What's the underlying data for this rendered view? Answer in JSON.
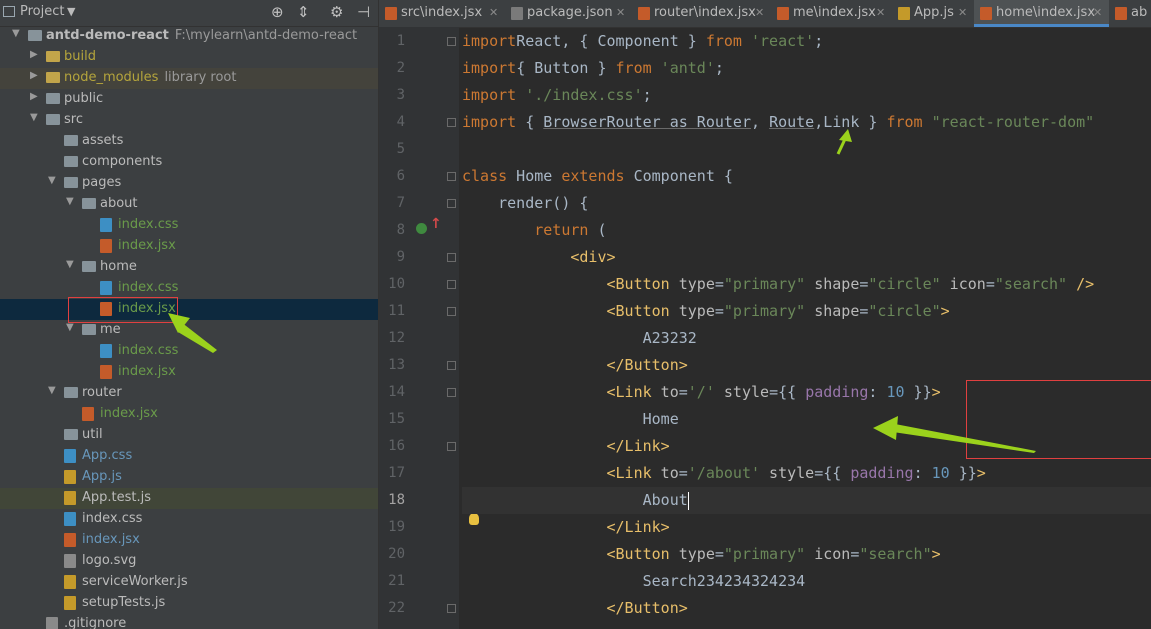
{
  "project_panel": {
    "title": "Project",
    "tree": [
      {
        "label": "antd-demo-react",
        "note": "F:\\mylearn\\antd-demo-react",
        "depth": 0,
        "kind": "folder",
        "expanded": true,
        "cls": "c-dim"
      },
      {
        "label": "build",
        "depth": 1,
        "kind": "folder-lib",
        "expanded": false,
        "cls": "c-yellow"
      },
      {
        "label": "node_modules",
        "note": "library root",
        "depth": 1,
        "kind": "folder-lib",
        "expanded": false,
        "cls": "c-yellow",
        "row": "hl-lib"
      },
      {
        "label": "public",
        "depth": 1,
        "kind": "folder",
        "expanded": false
      },
      {
        "label": "src",
        "depth": 1,
        "kind": "folder",
        "expanded": true
      },
      {
        "label": "assets",
        "depth": 2,
        "kind": "folder"
      },
      {
        "label": "components",
        "depth": 2,
        "kind": "folder"
      },
      {
        "label": "pages",
        "depth": 2,
        "kind": "folder",
        "expanded": true
      },
      {
        "label": "about",
        "depth": 3,
        "kind": "folder",
        "expanded": true
      },
      {
        "label": "index.css",
        "depth": 4,
        "kind": "css",
        "cls": "c-green"
      },
      {
        "label": "index.jsx",
        "depth": 4,
        "kind": "jsx",
        "cls": "c-green"
      },
      {
        "label": "home",
        "depth": 3,
        "kind": "folder",
        "expanded": true
      },
      {
        "label": "index.css",
        "depth": 4,
        "kind": "css",
        "cls": "c-green"
      },
      {
        "label": "index.jsx",
        "depth": 4,
        "kind": "jsx",
        "cls": "c-green",
        "row": "sel"
      },
      {
        "label": "me",
        "depth": 3,
        "kind": "folder",
        "expanded": true
      },
      {
        "label": "index.css",
        "depth": 4,
        "kind": "css",
        "cls": "c-green"
      },
      {
        "label": "index.jsx",
        "depth": 4,
        "kind": "jsx",
        "cls": "c-green"
      },
      {
        "label": "router",
        "depth": 2,
        "kind": "folder",
        "expanded": true
      },
      {
        "label": "index.jsx",
        "depth": 3,
        "kind": "jsx",
        "cls": "c-green"
      },
      {
        "label": "util",
        "depth": 2,
        "kind": "folder"
      },
      {
        "label": "App.css",
        "depth": 2,
        "kind": "css",
        "cls": "c-blue"
      },
      {
        "label": "App.js",
        "depth": 2,
        "kind": "js",
        "cls": "c-blue"
      },
      {
        "label": "App.test.js",
        "depth": 2,
        "kind": "js",
        "row": "hl-test"
      },
      {
        "label": "index.css",
        "depth": 2,
        "kind": "css"
      },
      {
        "label": "index.jsx",
        "depth": 2,
        "kind": "jsx",
        "cls": "c-blue"
      },
      {
        "label": "logo.svg",
        "depth": 2,
        "kind": "svg"
      },
      {
        "label": "serviceWorker.js",
        "depth": 2,
        "kind": "js"
      },
      {
        "label": "setupTests.js",
        "depth": 2,
        "kind": "js"
      },
      {
        "label": ".gitignore",
        "depth": 1,
        "kind": "svg"
      }
    ]
  },
  "editor": {
    "tabs": [
      {
        "label": "src\\index.jsx",
        "icon": "jsx",
        "active": false
      },
      {
        "label": "package.json",
        "icon": "json",
        "active": false
      },
      {
        "label": "router\\index.jsx",
        "icon": "jsx",
        "active": false
      },
      {
        "label": "me\\index.jsx",
        "icon": "jsx",
        "active": false
      },
      {
        "label": "App.js",
        "icon": "js",
        "active": false
      },
      {
        "label": "home\\index.jsx",
        "icon": "jsx",
        "active": true
      },
      {
        "label": "ab",
        "icon": "jsx",
        "active": false
      }
    ],
    "current_line": 18,
    "lines": [
      [
        [
          "kw",
          "import"
        ],
        [
          "",
          "React, { Component } "
        ],
        [
          "kw",
          "from"
        ],
        [
          "str",
          " 'react'"
        ],
        [
          "",
          ";"
        ]
      ],
      [
        [
          "kw",
          "import"
        ],
        [
          "",
          "",
          " { Button } "
        ],
        [
          "",
          "{ Button } "
        ],
        [
          "kw",
          "from"
        ],
        [
          "str",
          " 'antd'"
        ],
        [
          "",
          ";"
        ]
      ],
      [
        [
          "kw",
          "import"
        ],
        [
          "str",
          " './index.css'"
        ],
        [
          "",
          ";"
        ]
      ],
      [
        [
          "kw",
          "import"
        ],
        [
          "",
          " { "
        ],
        [
          "ul",
          "BrowserRouter as Router"
        ],
        [
          "",
          ", "
        ],
        [
          "ul",
          "Route"
        ],
        [
          "",
          ",Link } "
        ],
        [
          "kw",
          "from"
        ],
        [
          "str",
          " \"react-router-dom\""
        ]
      ],
      [
        [
          "",
          ""
        ]
      ],
      [
        [
          "kw",
          "class"
        ],
        [
          "",
          " Home "
        ],
        [
          "kw",
          "extends"
        ],
        [
          "",
          " Component {"
        ]
      ],
      [
        [
          "",
          "    render() {"
        ]
      ],
      [
        [
          "",
          "        "
        ],
        [
          "kw",
          "return"
        ],
        [
          "",
          " ("
        ]
      ],
      [
        [
          "",
          "            "
        ],
        [
          "tag",
          "<div>"
        ]
      ],
      [
        [
          "",
          "                "
        ],
        [
          "tag",
          "<Button"
        ],
        [
          "attr",
          " type"
        ],
        [
          "",
          "="
        ],
        [
          "str",
          "\"primary\""
        ],
        [
          "attr",
          " shape"
        ],
        [
          "",
          "="
        ],
        [
          "str",
          "\"circle\""
        ],
        [
          "attr",
          " icon"
        ],
        [
          "",
          "="
        ],
        [
          "str",
          "\"search\""
        ],
        [
          "tag",
          " />"
        ]
      ],
      [
        [
          "",
          "                "
        ],
        [
          "tag",
          "<Button"
        ],
        [
          "attr",
          " type"
        ],
        [
          "",
          "="
        ],
        [
          "str",
          "\"primary\""
        ],
        [
          "attr",
          " shape"
        ],
        [
          "",
          "="
        ],
        [
          "str",
          "\"circle\""
        ],
        [
          "tag",
          ">"
        ]
      ],
      [
        [
          "",
          "                    A23232"
        ]
      ],
      [
        [
          "",
          "                "
        ],
        [
          "tag",
          "</Button>"
        ]
      ],
      [
        [
          "",
          "                "
        ],
        [
          "tag",
          "<Link"
        ],
        [
          "attr",
          " to"
        ],
        [
          "",
          "="
        ],
        [
          "str",
          "'/'"
        ],
        [
          "attr",
          " style"
        ],
        [
          "",
          "={{ "
        ],
        [
          "prop",
          "padding"
        ],
        [
          "",
          ": "
        ],
        [
          "num",
          "10"
        ],
        [
          "",
          " }}"
        ],
        [
          "tag",
          ">"
        ]
      ],
      [
        [
          "",
          "                    Home"
        ]
      ],
      [
        [
          "",
          "                "
        ],
        [
          "tag",
          "</Link>"
        ]
      ],
      [
        [
          "",
          "                "
        ],
        [
          "tag",
          "<Link"
        ],
        [
          "attr",
          " to"
        ],
        [
          "",
          "="
        ],
        [
          "str",
          "'/about'"
        ],
        [
          "attr",
          " style"
        ],
        [
          "",
          "={{ "
        ],
        [
          "prop",
          "padding"
        ],
        [
          "",
          ": "
        ],
        [
          "num",
          "10"
        ],
        [
          "",
          " }}"
        ],
        [
          "tag",
          ">"
        ]
      ],
      [
        [
          "",
          "                    About"
        ],
        [
          "caret",
          ""
        ]
      ],
      [
        [
          "",
          "                "
        ],
        [
          "tag",
          "</Link>"
        ]
      ],
      [
        [
          "",
          "                "
        ],
        [
          "tag",
          "<Button"
        ],
        [
          "attr",
          " type"
        ],
        [
          "",
          "="
        ],
        [
          "str",
          "\"primary\""
        ],
        [
          "attr",
          " icon"
        ],
        [
          "",
          "="
        ],
        [
          "str",
          "\"search\""
        ],
        [
          "tag",
          ">"
        ]
      ],
      [
        [
          "",
          "                    Search234234324234"
        ]
      ],
      [
        [
          "",
          "                "
        ],
        [
          "tag",
          "</Button>"
        ]
      ]
    ],
    "fold_lines": [
      1,
      4,
      6,
      7,
      9,
      10,
      11,
      13,
      14,
      16,
      22
    ]
  },
  "colors": {
    "annotation_box": "#e04040",
    "annotation_arrow": "#9bd21c"
  }
}
